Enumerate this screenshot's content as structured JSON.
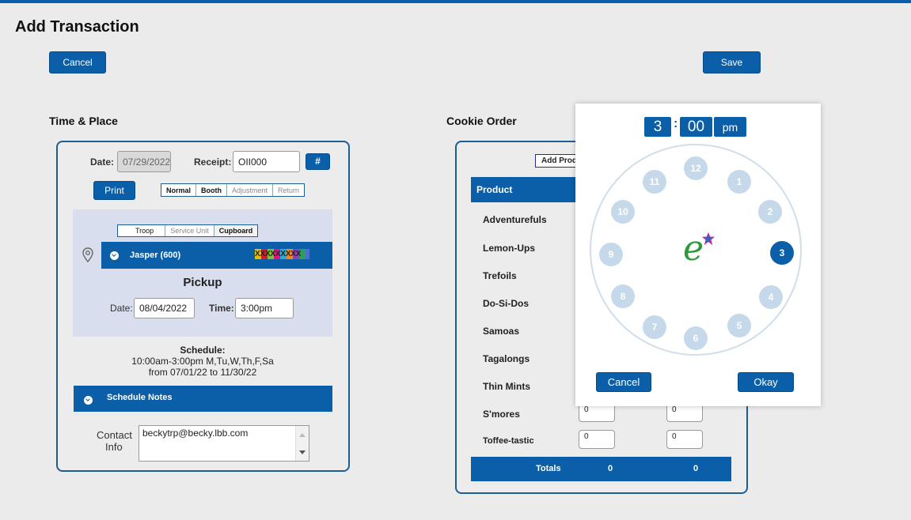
{
  "page": {
    "title": "Add Transaction",
    "cancel_label": "Cancel",
    "save_label": "Save"
  },
  "time_place": {
    "heading": "Time & Place",
    "date_label": "Date:",
    "date_value": "07/29/2022",
    "receipt_label": "Receipt:",
    "receipt_value": "OII000",
    "hash_label": "#",
    "print_label": "Print",
    "type_options": [
      "Normal",
      "Booth",
      "Adjustment",
      "Return"
    ],
    "type_selected": "Normal",
    "source_options": [
      "Troop",
      "Service Unit",
      "Cupboard"
    ],
    "source_selected": "Cupboard",
    "location_name": "Jasper (600)",
    "location_tag": "XXXXXXXXX",
    "pickup_heading": "Pickup",
    "pickup_date_label": "Date:",
    "pickup_date_value": "08/04/2022",
    "pickup_time_label": "Time:",
    "pickup_time_value": "3:00pm",
    "schedule_heading": "Schedule:",
    "schedule_line1": "10:00am-3:00pm M,Tu,W,Th,F,Sa",
    "schedule_line2": "from 07/01/22 to 11/30/22",
    "schedule_notes_label": "Schedule Notes",
    "contact_label_1": "Contact",
    "contact_label_2": "Info",
    "contact_value": "beckytrp@becky.lbb.com"
  },
  "cookie_order": {
    "heading": "Cookie Order",
    "add_product_label": "Add Prod",
    "product_header": "Product",
    "products": [
      "Adventurefuls",
      "Lemon-Ups",
      "Trefoils",
      "Do-Si-Dos",
      "Samoas",
      "Tagalongs",
      "Thin Mints",
      "S'mores",
      "Toffee-tastic"
    ],
    "smores_qty": [
      "0",
      "0"
    ],
    "toffee_qty": [
      "0",
      "0"
    ],
    "totals_label": "Totals",
    "totals_values": [
      "0",
      "0"
    ]
  },
  "time_picker": {
    "hour": "3",
    "separator": ":",
    "minute": "00",
    "ampm": "pm",
    "dial_numbers": [
      "12",
      "1",
      "2",
      "3",
      "4",
      "5",
      "6",
      "7",
      "8",
      "9",
      "10",
      "11"
    ],
    "selected_hour": "3",
    "logo_letter": "e",
    "cancel_label": "Cancel",
    "okay_label": "Okay"
  },
  "colors": {
    "accent": "#0b5ea8",
    "dial_light": "#c5d9ea",
    "panel_border": "#1e5d93"
  }
}
